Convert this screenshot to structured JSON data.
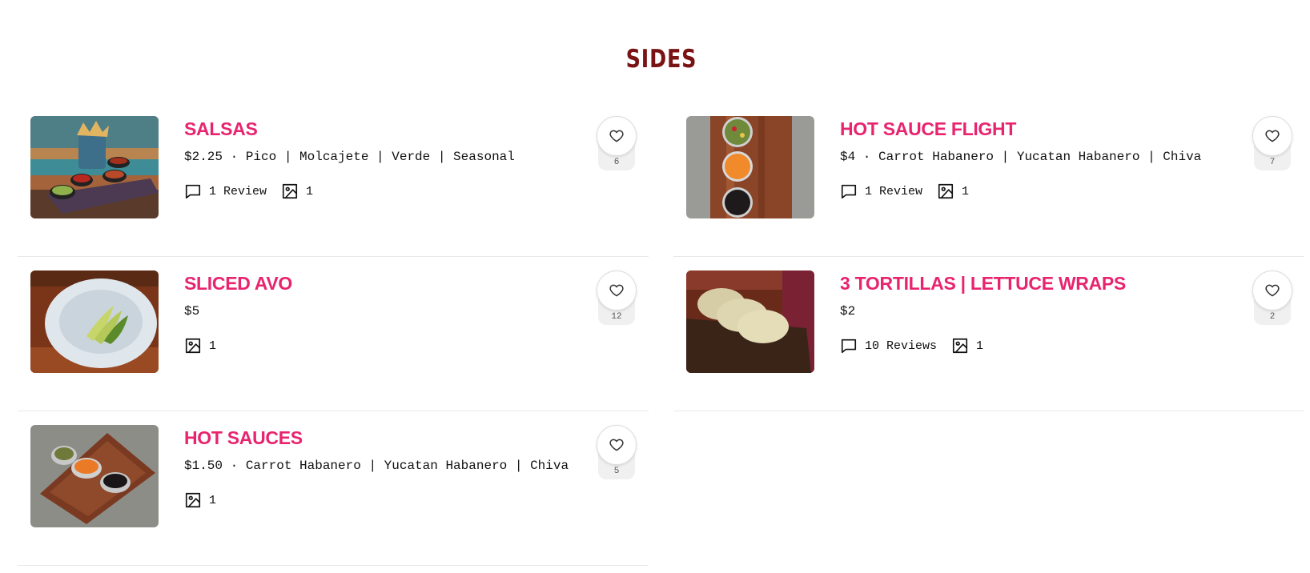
{
  "theme": {
    "accent": "#e8246f",
    "title_color": "#7a1414"
  },
  "section": {
    "title": "SIDES"
  },
  "items": [
    {
      "name": "SALSAS",
      "description": "$2.25 · Pico | Molcajete | Verde | Seasonal",
      "reviews": "1 Review",
      "photos": "1",
      "likes": "6",
      "image": "salsas-photo"
    },
    {
      "name": "HOT SAUCE FLIGHT",
      "description": "$4 · Carrot Habanero | Yucatan Habanero | Chiva",
      "reviews": "1 Review",
      "photos": "1",
      "likes": "7",
      "image": "hot-sauce-flight-photo"
    },
    {
      "name": "SLICED AVO",
      "description": "$5",
      "photos": "1",
      "likes": "12",
      "image": "sliced-avo-photo"
    },
    {
      "name": "3 TORTILLAS | LETTUCE WRAPS",
      "description": "$2",
      "reviews": "10 Reviews",
      "photos": "1",
      "likes": "2",
      "image": "tortillas-photo"
    },
    {
      "name": "HOT SAUCES",
      "description": "$1.50 · Carrot Habanero | Yucatan Habanero | Chiva",
      "photos": "1",
      "likes": "5",
      "image": "hot-sauces-photo"
    }
  ],
  "icons": {
    "review": "comment-icon",
    "photo": "image-icon",
    "like": "heart-icon"
  }
}
